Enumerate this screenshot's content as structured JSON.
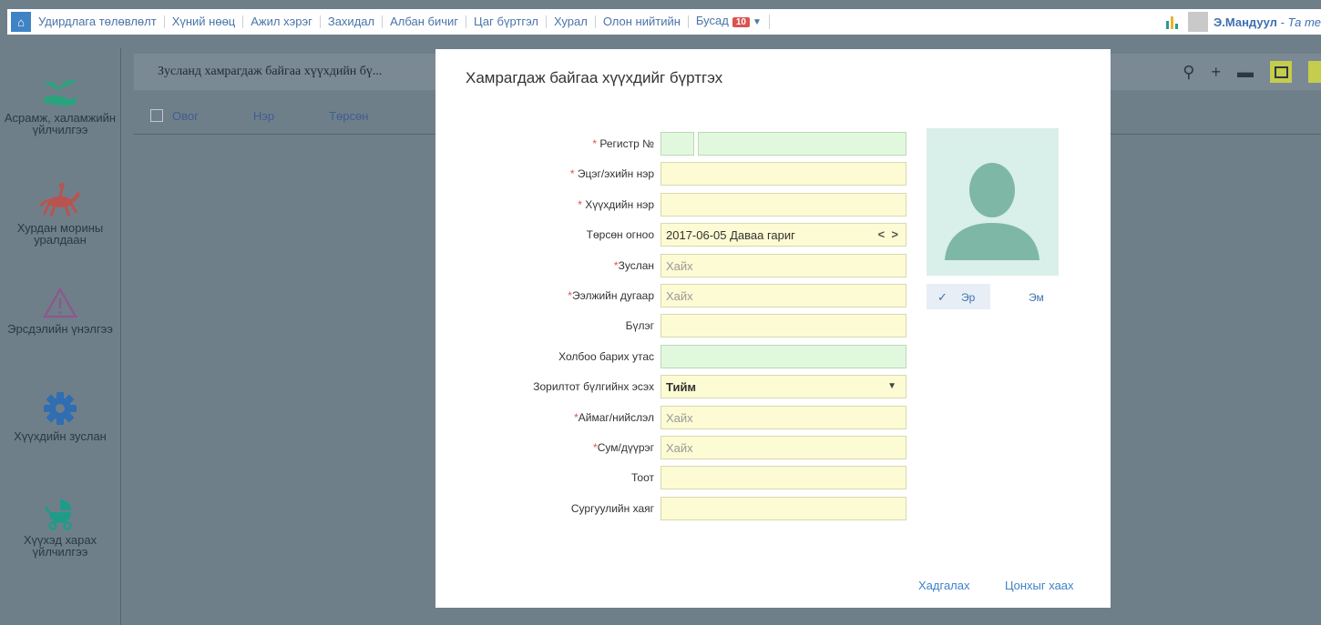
{
  "topnav": {
    "items": [
      "Удирдлага төлөвлөлт",
      "Хүний нөөц",
      "Ажил хэрэг",
      "Захидал",
      "Албан бичиг",
      "Цаг бүртгэл",
      "Хурал",
      "Олон нийтийн"
    ],
    "more_label": "Бусад",
    "more_badge": "10",
    "user_name": "Э.Мандуул",
    "user_suffix": " - Та те"
  },
  "sidebar": {
    "items": [
      {
        "label": "Асрамж, халамжийн үйлчилгээ",
        "icon": "hand-plant-icon"
      },
      {
        "label": "Хурдан морины уралдаан",
        "icon": "horse-rider-icon"
      },
      {
        "label": "Эрсдэлийн үнэлгээ",
        "icon": "warning-triangle-icon"
      },
      {
        "label": "Хүүхдийн зуслан",
        "icon": "gear-icon"
      },
      {
        "label": "Хүүхэд харах үйлчилгээ",
        "icon": "stroller-icon"
      }
    ]
  },
  "main": {
    "breadcrumb": "Зусланд хамрагдаж байгаа хүүхдийн бү...",
    "columns": [
      "Овог",
      "Нэр",
      "Төрсөн"
    ]
  },
  "modal": {
    "title": "Хамрагдаж байгаа хүүхдийг бүртгэх",
    "fields": {
      "register": {
        "label": "Регистр №",
        "required": "*"
      },
      "parent_name": {
        "label": "Эцэг/эхийн нэр",
        "required": "*"
      },
      "child_name": {
        "label": "Хүүхдийн нэр",
        "required": "*"
      },
      "birth_date": {
        "label": "Төрсөн огноо",
        "value": "2017-06-05 Даваа гариг"
      },
      "camp": {
        "label": "Зуслан",
        "required": "*",
        "placeholder": "Хайх"
      },
      "shift_no": {
        "label": "Ээлжийн дугаар",
        "required": "*",
        "placeholder": "Хайх"
      },
      "group": {
        "label": "Бүлэг"
      },
      "phone": {
        "label": "Холбоо барих утас"
      },
      "target_group": {
        "label": "Зорилтот бүлгийнх эсэх",
        "value": "Тийм"
      },
      "province": {
        "label": "Аймаг/нийслэл",
        "required": "*",
        "placeholder": "Хайх"
      },
      "district": {
        "label": "Сум/дүүрэг",
        "required": "*",
        "placeholder": "Хайх"
      },
      "apartment": {
        "label": "Тоот"
      },
      "school_address": {
        "label": "Сургуулийн хаяг"
      }
    },
    "gender": {
      "male": "Эр",
      "female": "Эм",
      "selected": "male"
    },
    "save_label": "Хадгалах",
    "close_label": "Цонхыг хаах"
  },
  "colors": {
    "overlay": "#6f7f8a",
    "field_yellow": "#fdfbd3",
    "field_green": "#e2f8de",
    "link_blue": "#3f82c8",
    "photo_bg": "#d9efea"
  }
}
